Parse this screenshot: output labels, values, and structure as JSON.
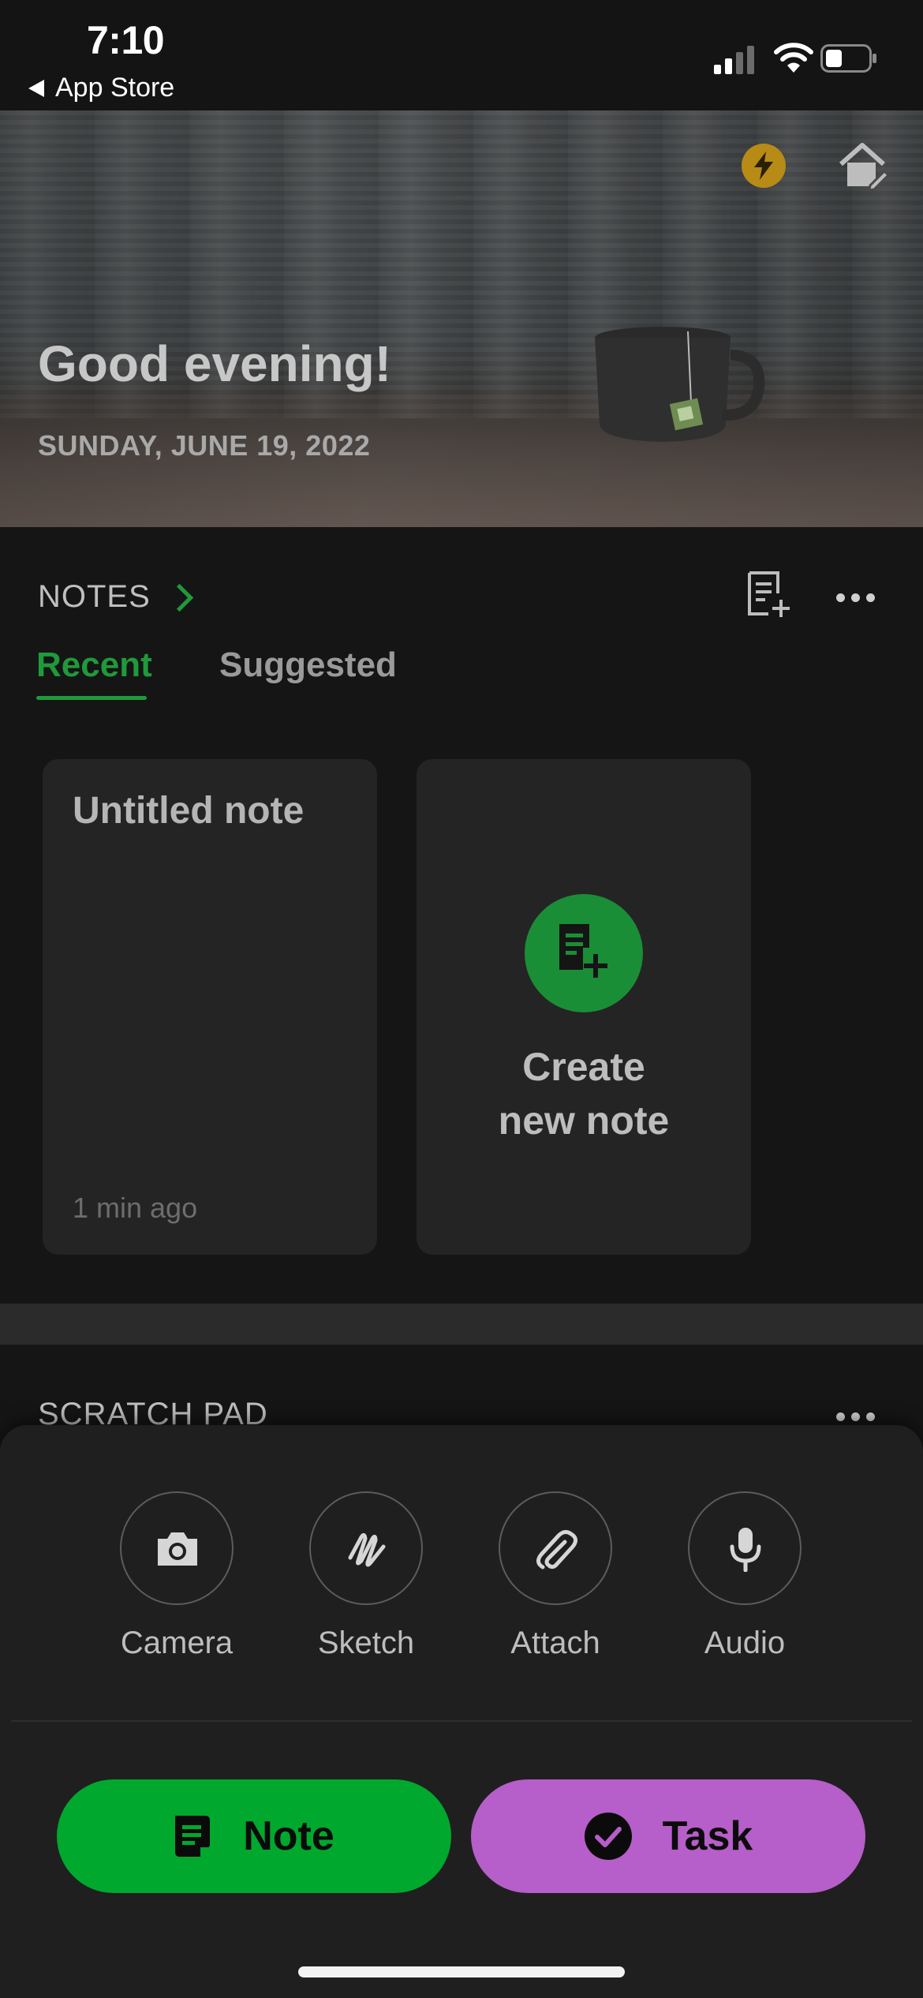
{
  "status_bar": {
    "time": "7:10",
    "back_label": "App Store"
  },
  "hero": {
    "greeting": "Good evening!",
    "date": "SUNDAY, JUNE 19, 2022",
    "icons": [
      "bolt-icon",
      "home-edit-icon"
    ],
    "accent_color": "#b78b15"
  },
  "notes": {
    "section_title": "NOTES",
    "tabs": [
      {
        "label": "Recent",
        "active": true
      },
      {
        "label": "Suggested",
        "active": false
      }
    ],
    "cards": [
      {
        "title": "Untitled note",
        "time": "1 min ago"
      }
    ],
    "create_label_line1": "Create",
    "create_label_line2": "new note",
    "accent_color": "#1f9a3b"
  },
  "scratch_pad": {
    "title": "SCRATCH PAD"
  },
  "quick_actions": [
    {
      "label": "Camera",
      "icon": "camera-icon"
    },
    {
      "label": "Sketch",
      "icon": "sketch-icon"
    },
    {
      "label": "Attach",
      "icon": "paperclip-icon"
    },
    {
      "label": "Audio",
      "icon": "microphone-icon"
    }
  ],
  "buttons": {
    "note_label": "Note",
    "note_color": "#00a82d",
    "task_label": "Task",
    "task_color": "#b65ec9"
  }
}
